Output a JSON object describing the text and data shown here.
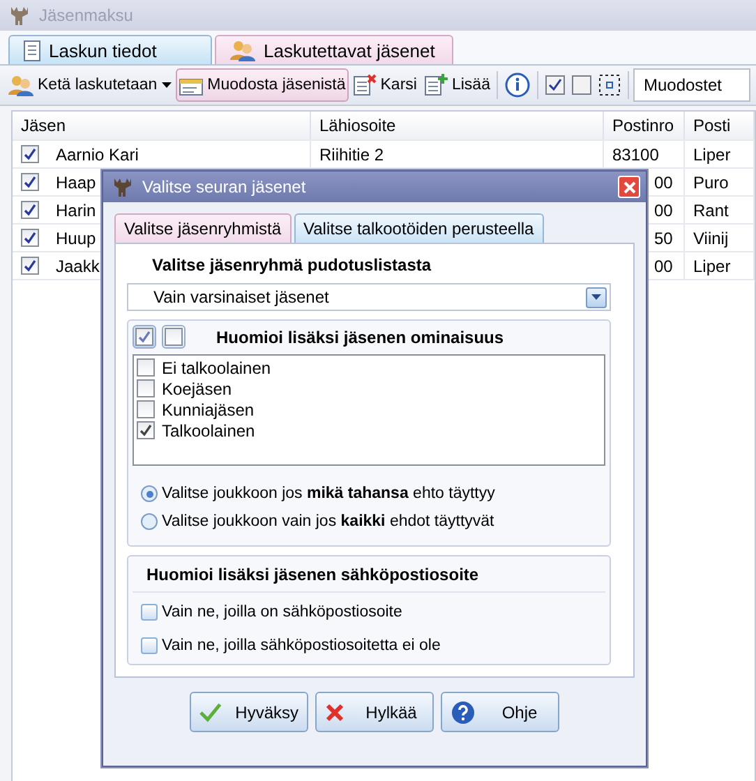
{
  "window": {
    "title": "Jäsenmaksu"
  },
  "tabs": [
    {
      "label": "Laskun tiedot",
      "selected": false
    },
    {
      "label": "Laskutettavat jäsenet",
      "selected": true
    }
  ],
  "toolbar": {
    "items": [
      {
        "kind": "dropdown",
        "label": "Ketä laskutetaan",
        "pressed": false
      },
      {
        "kind": "button",
        "label": "Muodosta jäsenistä",
        "pressed": true
      },
      {
        "kind": "button",
        "label": "Karsi",
        "pressed": false
      },
      {
        "kind": "button",
        "label": "Lisää",
        "pressed": false
      },
      {
        "kind": "separator"
      },
      {
        "kind": "icon"
      },
      {
        "kind": "separator"
      },
      {
        "kind": "icon"
      },
      {
        "kind": "icon"
      },
      {
        "kind": "icon"
      },
      {
        "kind": "separator"
      }
    ],
    "field": "Muodostet"
  },
  "table": {
    "columns": [
      "Jäsen",
      "Lähiosoite",
      "Postinro",
      "Posti"
    ],
    "rows": [
      {
        "checked": true,
        "name": "Aarnio Kari",
        "address": "Riihitie 2",
        "postinro": "83100",
        "posti": "Liper"
      },
      {
        "checked": true,
        "name": "Haap",
        "postinro": "00",
        "posti": "Puro"
      },
      {
        "checked": true,
        "name": "Harin",
        "postinro": "00",
        "posti": "Rant"
      },
      {
        "checked": true,
        "name": "Huup",
        "postinro": "50",
        "posti": "Viinij"
      },
      {
        "checked": true,
        "name": "Jaakk",
        "postinro": "00",
        "posti": "Liper"
      }
    ]
  },
  "dialog": {
    "title": "Valitse seuran jäsenet",
    "tabs": [
      {
        "label": "Valitse jäsenryhmistä",
        "selected": true
      },
      {
        "label": "Valitse talkootöiden perusteella",
        "selected": false
      }
    ],
    "group_heading": "Valitse jäsenryhmä pudotuslistasta",
    "group_select": "Vain varsinaiset jäsenet",
    "traits": {
      "heading": "Huomioi lisäksi jäsenen ominaisuus",
      "enabled": true,
      "items": [
        {
          "label": "Ei talkoolainen",
          "checked": false
        },
        {
          "label": "Koejäsen",
          "checked": false
        },
        {
          "label": "Kunniajäsen",
          "checked": false
        },
        {
          "label": "Talkoolainen",
          "checked": true
        }
      ],
      "options": [
        {
          "label": "Valitse joukkoon jos **mikä tahansa** ehto täyttyy",
          "selected": true
        },
        {
          "label": "Valitse joukkoon vain jos **kaikki** ehdot täyttyvät",
          "selected": false
        }
      ]
    },
    "email": {
      "heading": "Huomioi lisäksi jäsenen sähköpostiosoite",
      "items": [
        {
          "label": "Vain ne, joilla on sähköpostiosoite",
          "checked": false
        },
        {
          "label": "Vain ne, joilla sähköpostiosoitetta ei ole",
          "checked": false
        }
      ]
    },
    "buttons": [
      {
        "label": "Hyväksy"
      },
      {
        "label": "Hylkää"
      },
      {
        "label": "Ohje"
      }
    ]
  }
}
